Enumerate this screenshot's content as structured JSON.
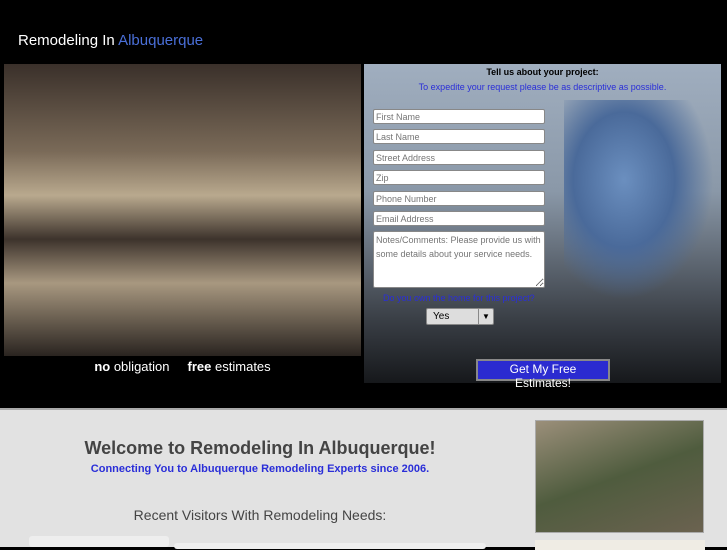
{
  "header": {
    "title_prefix": "Remodeling In",
    "title_city": "Albuquerque"
  },
  "hero": {
    "tagline_no": "no",
    "tagline_obligation": "obligation",
    "tagline_free": "free",
    "tagline_estimates": "estimates"
  },
  "form": {
    "title": "Tell us about your project:",
    "subtitle": "To expedite your request please be as descriptive as possible.",
    "first_name": "First Name",
    "last_name": "Last Name",
    "street": "Street Address",
    "zip": "Zip",
    "phone": "Phone Number",
    "email": "Email Address",
    "notes": "Notes/Comments: Please provide us with some details about your service needs.",
    "own_label": "Do you own the home for this project?",
    "own_value": "Yes",
    "submit": "Get My Free Estimates!"
  },
  "main": {
    "welcome": "Welcome to Remodeling In Albuquerque!",
    "connecting": "Connecting You to Albuquerque Remodeling Experts since 2006.",
    "recent": "Recent Visitors With Remodeling Needs:"
  }
}
